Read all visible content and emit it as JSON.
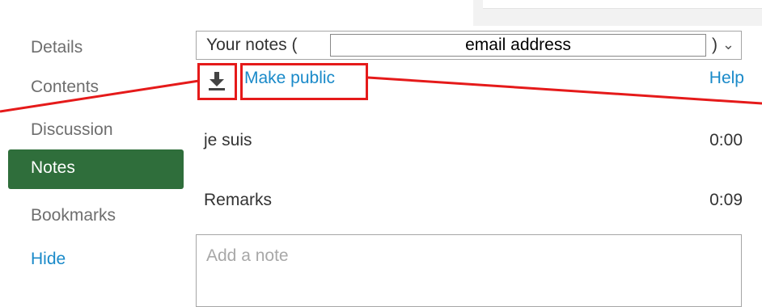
{
  "sidebar": {
    "items": [
      {
        "label": "Details"
      },
      {
        "label": "Contents"
      },
      {
        "label": "Discussion"
      },
      {
        "label": "Notes"
      },
      {
        "label": "Bookmarks"
      },
      {
        "label": "Hide"
      }
    ],
    "active_label": "Notes"
  },
  "notes_panel": {
    "selector_value": "Your notes (",
    "selector_suffix": ")",
    "email_overlay": "email address",
    "make_public_label": "Make public",
    "help_label": "Help",
    "download_icon": "download-icon",
    "notes": [
      {
        "text": "je suis",
        "time": "0:00"
      },
      {
        "text": "Remarks",
        "time": "0:09"
      }
    ],
    "add_note_placeholder": "Add a note"
  },
  "colors": {
    "accent_green": "#2f6e3b",
    "link_blue": "#1a8ac9",
    "highlight_red": "#e51a1a"
  }
}
